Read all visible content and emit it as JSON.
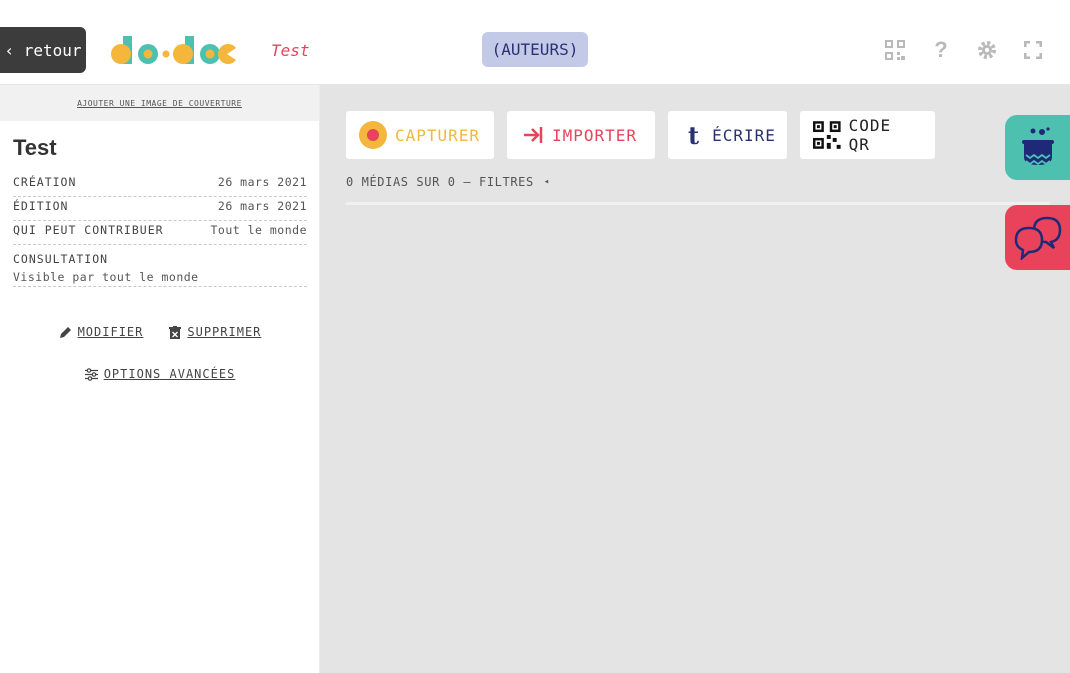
{
  "window": {
    "buttons": [
      "close",
      "minimize",
      "maximize"
    ]
  },
  "topbar": {
    "back_label": "‹ retour",
    "logo_name": "do•doc",
    "project_title": "Test",
    "authors_label": "(AUTEURS)",
    "icons": [
      "qr-code-icon",
      "help-icon",
      "settings-icon",
      "fullscreen-icon"
    ]
  },
  "sidebar": {
    "cover_link": "AJOUTER UNE IMAGE DE COUVERTURE",
    "title": "Test",
    "meta": {
      "creation_key": "CRÉATION",
      "creation_val": "26 mars 2021",
      "edition_key": "ÉDITION",
      "edition_val": "26 mars 2021",
      "contrib_key": "QUI PEUT CONTRIBUER",
      "contrib_val": "Tout le monde",
      "consult_key": "CONSULTATION",
      "consult_val": "Visible par tout le monde"
    },
    "modify_label": "MODIFIER",
    "delete_label": "SUPPRIMER",
    "advanced_label": "OPTIONS AVANCÉES"
  },
  "main": {
    "capture_label": "CAPTURER",
    "import_label": "IMPORTER",
    "write_label": "ÉCRIRE",
    "qr_label": "CODE QR",
    "media_count": "0 MÉDIAS SUR 0 — FILTRES",
    "filter_arrow": "◂"
  },
  "colors": {
    "accent_yellow": "#f4b63b",
    "accent_red": "#e9435c",
    "accent_blue": "#2a3170",
    "accent_teal": "#4ec0b0",
    "authors_bg": "#c3cae8"
  }
}
